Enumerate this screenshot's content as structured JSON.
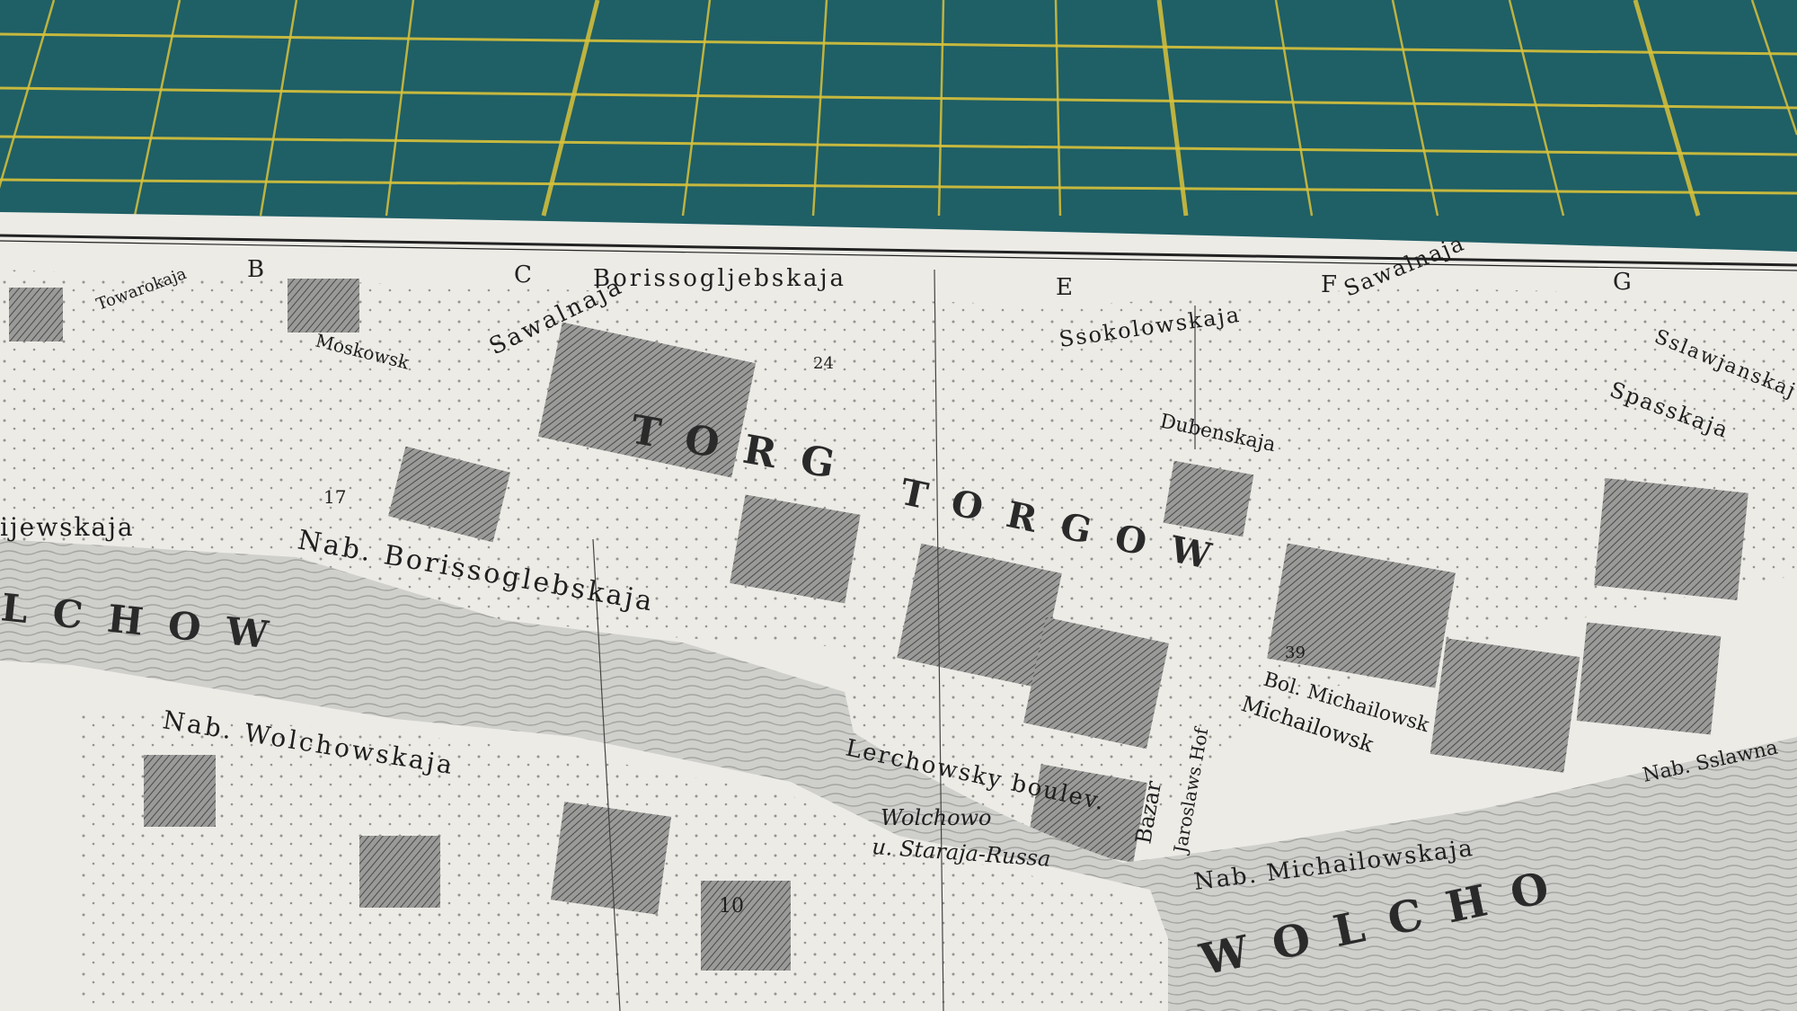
{
  "colors": {
    "mat": "#1f5f66",
    "mat_grid": "#d9c23a",
    "paper": "#ecebe6",
    "river": "#c9c9c6",
    "block_dark": "#7b7b7b",
    "ink": "#1e1e1e"
  },
  "column_letters": [
    "B",
    "C",
    "E",
    "F",
    "G"
  ],
  "street_labels": {
    "borissogljebskaja": "Borissogljebskaja",
    "ssokolowskaja": "Ssokolowskaja",
    "sawalnaja_left": "Sawalnaja",
    "sawalnaja_right": "Sawalnaja",
    "moskowsk": "Moskowsk",
    "towarokaja": "Towarokaja",
    "ijewskaja": "ijewskaja",
    "nab_borissoglebskaja": "Nab. Borissoglebskaja",
    "nab_wolchowskaja": "Nab. Wolchowskaja",
    "nab_michailowskaja": "Nab. Michailowskaja",
    "nab_sslawnaja": "Nab. Sslawna",
    "lerchowsky_boulev": "Lerchowsky boulev.",
    "michailowsk": "Michailowsk",
    "dubenskaja": "Dubenskaja",
    "spasskaja": "Spasskaja",
    "sslawjanskaja": "Sslawjanskaj",
    "bazar": "Bazar",
    "jaroslaws_hof": "Jaroslaws Hof",
    "wolchowo": "Wolchowo",
    "staraja_russa": "u. Staraja-Russa",
    "bol_michailowsk": "Bol. Michailowsk"
  },
  "district_labels": {
    "torg": "TORG",
    "torgowaja": "TORGOW",
    "wolchow_upper": "LCHOW",
    "wolchow_lower": "WOLCHO",
    "wolcho_right": "WOLCHO"
  },
  "numbers": [
    "17",
    "24",
    "10",
    "39"
  ]
}
